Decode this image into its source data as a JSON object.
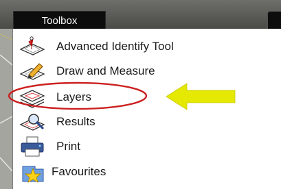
{
  "toolbox": {
    "title": "Toolbox"
  },
  "menu": {
    "items": [
      {
        "label": "Advanced Identify Tool",
        "icon": "identify-icon"
      },
      {
        "label": "Draw and Measure",
        "icon": "draw-measure-icon"
      },
      {
        "label": "Layers",
        "icon": "layers-icon"
      },
      {
        "label": "Results",
        "icon": "results-icon"
      },
      {
        "label": "Print",
        "icon": "printer-icon"
      },
      {
        "label": "Favourites",
        "icon": "star-favourites-icon"
      }
    ]
  },
  "annotation": {
    "highlight_color": "#cc2020",
    "arrow_color": "#e5e800"
  }
}
